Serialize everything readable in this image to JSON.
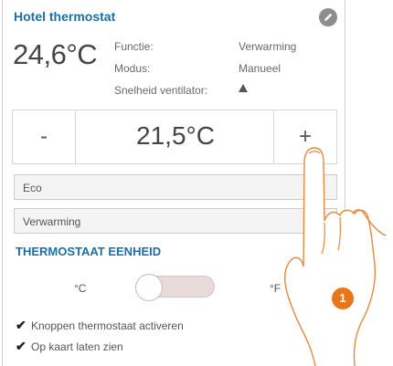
{
  "header": {
    "title": "Hotel thermostat"
  },
  "status": {
    "current_temp": "24,6°C",
    "rows": [
      {
        "label": "Functie:",
        "value": "Verwarming"
      },
      {
        "label": "Modus:",
        "value": "Manueel"
      },
      {
        "label": "Snelheid ventilator:",
        "icon": "warning-icon"
      }
    ]
  },
  "setpoint": {
    "minus": "-",
    "value": "21,5°C",
    "plus": "+"
  },
  "dropdowns": {
    "mode": "Eco",
    "function": "Verwarming"
  },
  "unit_section": {
    "title": "THERMOSTAAT EENHEID",
    "celsius": "°C",
    "fahrenheit": "°F",
    "selected": "°C"
  },
  "checkboxes": [
    {
      "label": "Knoppen thermostaat activeren",
      "checked": true
    },
    {
      "label": "Op kaart laten zien",
      "checked": true
    }
  ],
  "callout": {
    "number": "1",
    "color": "#e8751a"
  },
  "colors": {
    "accent": "#1c6fa3",
    "edit_button": "#8d8d8d"
  }
}
